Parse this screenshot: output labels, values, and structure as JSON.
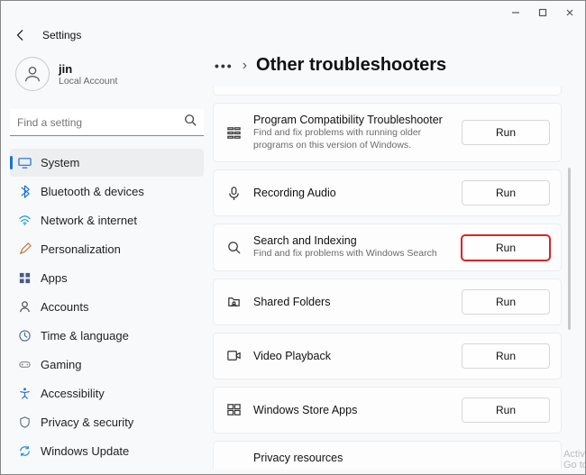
{
  "window": {
    "title": "Settings"
  },
  "user": {
    "name": "jin",
    "subtitle": "Local Account"
  },
  "search": {
    "placeholder": "Find a setting"
  },
  "nav": {
    "items": [
      {
        "label": "System",
        "icon": "system-icon",
        "color": "#1972d6",
        "active": true
      },
      {
        "label": "Bluetooth & devices",
        "icon": "bluetooth-icon",
        "color": "#1972d6"
      },
      {
        "label": "Network & internet",
        "icon": "wifi-icon",
        "color": "#18a0c8"
      },
      {
        "label": "Personalization",
        "icon": "brush-icon",
        "color": "#c07030"
      },
      {
        "label": "Apps",
        "icon": "apps-icon",
        "color": "#4a5a82"
      },
      {
        "label": "Accounts",
        "icon": "person-icon",
        "color": "#555"
      },
      {
        "label": "Time & language",
        "icon": "clock-globe-icon",
        "color": "#4b6a93"
      },
      {
        "label": "Gaming",
        "icon": "gamepad-icon",
        "color": "#888"
      },
      {
        "label": "Accessibility",
        "icon": "accessibility-icon",
        "color": "#2d72c9"
      },
      {
        "label": "Privacy & security",
        "icon": "shield-icon",
        "color": "#6a7a86"
      },
      {
        "label": "Windows Update",
        "icon": "update-icon",
        "color": "#1e8fd0"
      }
    ]
  },
  "page": {
    "breadcrumb_dots": "•••",
    "breadcrumb_sep": "›",
    "title": "Other troubleshooters"
  },
  "troubleshooters": {
    "run_label": "Run",
    "items": [
      {
        "title": "Program Compatibility Troubleshooter",
        "sub": "Find and fix problems with running older programs on this version of Windows.",
        "icon": "compat-icon"
      },
      {
        "title": "Recording Audio",
        "icon": "mic-icon"
      },
      {
        "title": "Search and Indexing",
        "sub": "Find and fix problems with Windows Search",
        "icon": "search-icon",
        "highlight": true
      },
      {
        "title": "Shared Folders",
        "icon": "shared-folder-icon"
      },
      {
        "title": "Video Playback",
        "icon": "video-icon"
      },
      {
        "title": "Windows Store Apps",
        "icon": "store-icon"
      },
      {
        "title": "Privacy resources",
        "icon": ""
      }
    ]
  },
  "watermark": {
    "line1": "Activate W",
    "line2": "Go to Settin"
  }
}
